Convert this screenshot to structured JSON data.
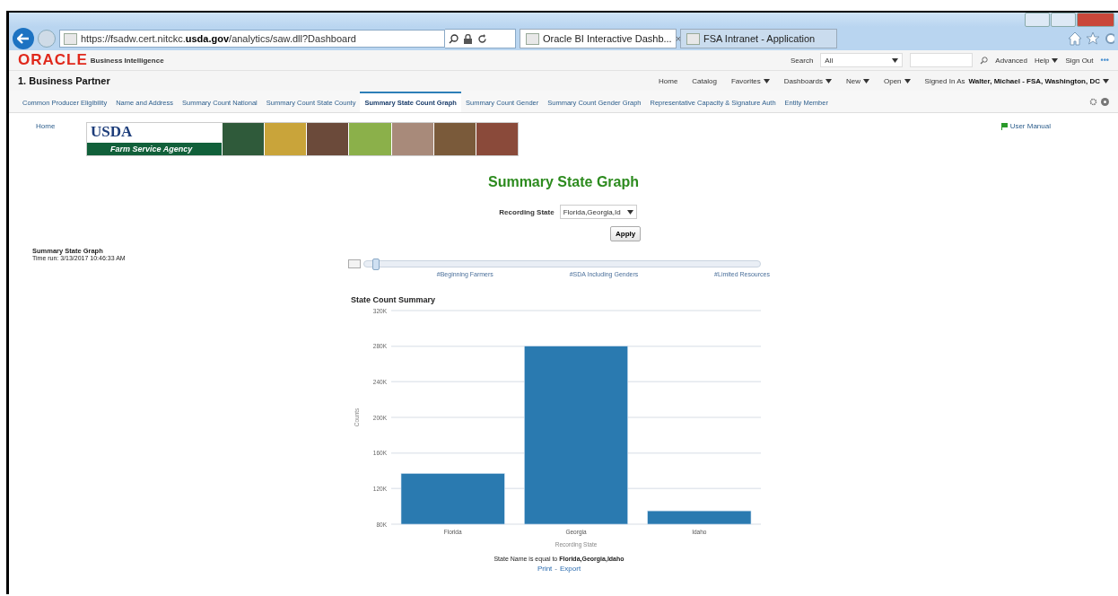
{
  "browser": {
    "url": "https://fsadw.cert.nitckc.**usda.gov**/analytics/saw.dll?Dashboard",
    "tabs": [
      {
        "label": "Oracle BI Interactive Dashb...",
        "selected": true,
        "close": "×"
      },
      {
        "label": "FSA Intranet - Application",
        "selected": false
      }
    ]
  },
  "header": {
    "logo": "ORACLE",
    "product": "Business Intelligence",
    "search_label": "Search",
    "search_scope": "All",
    "links": [
      {
        "label": "Advanced",
        "dropdown": false
      },
      {
        "label": "Help",
        "dropdown": true
      },
      {
        "label": "Sign Out",
        "dropdown": false
      }
    ],
    "more": "•••"
  },
  "dashboard": {
    "title": "1. Business Partner",
    "nav": [
      {
        "label": "Home",
        "dropdown": false
      },
      {
        "label": "Catalog",
        "dropdown": false
      },
      {
        "label": "Favorites",
        "dropdown": true
      },
      {
        "label": "Dashboards",
        "dropdown": true
      },
      {
        "label": "New",
        "dropdown": true
      },
      {
        "label": "Open",
        "dropdown": true
      }
    ],
    "signed_in_label": "Signed In As",
    "user": "Walter, Michael - FSA, Washington, DC"
  },
  "tabs": [
    {
      "label": "Common Producer Eligibility",
      "selected": false
    },
    {
      "label": "Name and Address",
      "selected": false
    },
    {
      "label": "Summary Count National",
      "selected": false
    },
    {
      "label": "Summary Count State County",
      "selected": false
    },
    {
      "label": "Summary State Count Graph",
      "selected": true
    },
    {
      "label": "Summary Count Gender",
      "selected": false
    },
    {
      "label": "Summary Count Gender Graph",
      "selected": false
    },
    {
      "label": "Representative Capacity & Signature Auth",
      "selected": false
    },
    {
      "label": "Entity Member",
      "selected": false
    }
  ],
  "content": {
    "home_link": "Home",
    "banner": {
      "agency_short": "USDA",
      "agency": "Farm Service Agency"
    },
    "user_manual": "User Manual",
    "page_title": "Summary State Graph",
    "prompt": {
      "label": "Recording State",
      "value": "Florida,Georgia,Id",
      "button": "Apply"
    },
    "report": {
      "title": "Summary State Graph",
      "time_run": "Time run: 3/13/2017 10:46:33 AM"
    },
    "slider": {
      "level": 0.02,
      "labels": [
        "#Beginning Farmers",
        "#SDA Including Genders",
        "#Limited Resources"
      ]
    },
    "chart": {
      "chart_data": {
        "type": "bar",
        "title": "State Count Summary",
        "xlabel": "Recording State",
        "ylabel": "Counts",
        "categories": [
          "Florida",
          "Georgia",
          "Idaho"
        ],
        "series": [
          {
            "color": "#2a7ab0",
            "values": [
              137000,
              280000,
              95000
            ]
          }
        ],
        "grid": true,
        "ylim": [
          80000,
          320000
        ],
        "yticks": [
          {
            "value": 80000,
            "label": "80K"
          },
          {
            "value": 120000,
            "label": "120K"
          },
          {
            "value": 160000,
            "label": "160K"
          },
          {
            "value": 200000,
            "label": "200K"
          },
          {
            "value": 240000,
            "label": "240K"
          },
          {
            "value": 280000,
            "label": "280K"
          },
          {
            "value": 320000,
            "label": "320K"
          }
        ]
      }
    },
    "filter": "State Name is equal to **Florida,Georgia,Idaho**",
    "links": [
      "Print",
      "Export"
    ],
    "link_separator": "-"
  }
}
